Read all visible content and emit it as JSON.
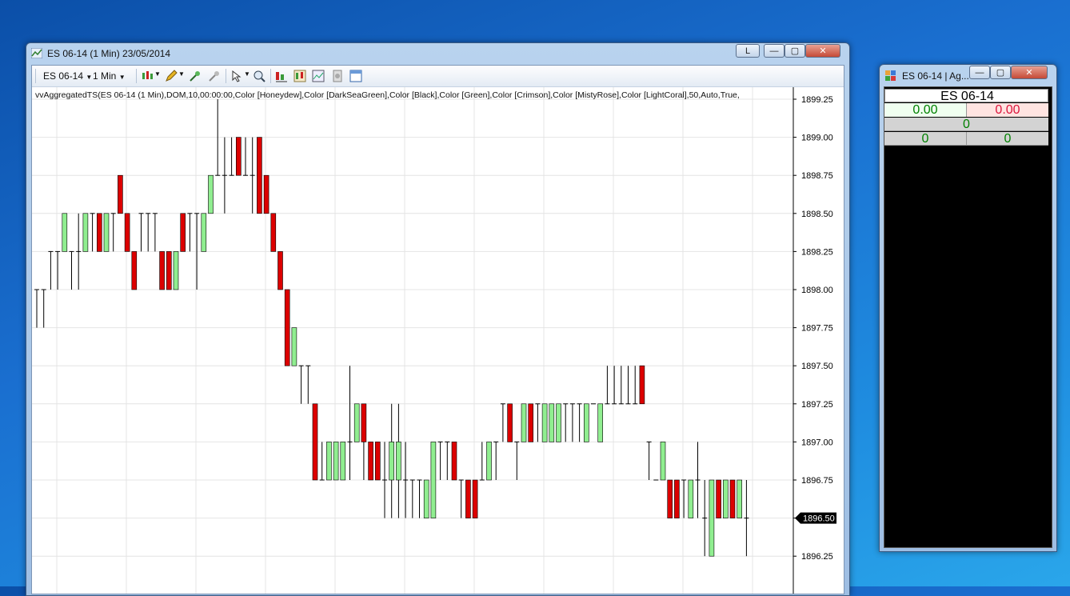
{
  "chart_window": {
    "title": "ES 06-14 (1 Min)  23/05/2014",
    "caption_buttons": {
      "link": "L",
      "minimize": "—",
      "maximize": "▢",
      "close": "✕"
    },
    "toolbar": {
      "instrument": "ES 06-14",
      "interval": "1 Min",
      "icons": [
        "chart-style-icon",
        "drawing-pencil-icon",
        "crosshair-icon",
        "zoom-cross-icon",
        "pointer-icon",
        "magnifier-icon",
        "indicators-icon",
        "strategies-icon",
        "data-box-icon",
        "properties-icon",
        "layout-icon"
      ]
    },
    "indicator_label": "vvAggregatedTS(ES 06-14 (1 Min),DOM,10,00:00:00,Color [Honeydew],Color [DarkSeaGreen],Color [Black],Color [Green],Color [Crimson],Color [MistyRose],Color [LightCoral],50,Auto,True,"
  },
  "dom_window": {
    "title": "ES 06-14 | Ag...",
    "caption_buttons": {
      "minimize": "—",
      "maximize": "▢",
      "close": "✕"
    },
    "header": "ES 06-14",
    "bid_value": "0.00",
    "ask_value": "0.00",
    "total_value": "0",
    "left_count": "0",
    "right_count": "0",
    "colors": {
      "bid_bg": "#f0fff0",
      "ask_bg": "#ffe4e1",
      "value_green": "#008000",
      "value_red": "#dc143c"
    }
  },
  "chart_data": {
    "type": "candlestick",
    "title": "",
    "xlabel": "",
    "ylabel": "",
    "ylim": [
      1896.2,
      1899.3
    ],
    "y_ticks": [
      "1899.25",
      "1899.00",
      "1898.75",
      "1898.50",
      "1898.25",
      "1898.00",
      "1897.75",
      "1897.50",
      "1897.25",
      "1897.00",
      "1896.75",
      "1896.50",
      "1896.25"
    ],
    "last_price": "1896.50",
    "colors": {
      "up": "#90ee90",
      "down": "#dc0000",
      "wick": "#000000",
      "last_price_bg": "#000000"
    },
    "bars": [
      {
        "o": 1898.0,
        "h": 1898.0,
        "l": 1897.75,
        "c": 1898.0
      },
      {
        "o": 1898.0,
        "h": 1898.0,
        "l": 1897.75,
        "c": 1898.0
      },
      {
        "o": 1898.25,
        "h": 1898.25,
        "l": 1898.0,
        "c": 1898.25
      },
      {
        "o": 1898.25,
        "h": 1898.25,
        "l": 1898.0,
        "c": 1898.25
      },
      {
        "o": 1898.25,
        "h": 1898.5,
        "l": 1898.25,
        "c": 1898.5
      },
      {
        "o": 1898.25,
        "h": 1898.25,
        "l": 1898.0,
        "c": 1898.25
      },
      {
        "o": 1898.25,
        "h": 1898.5,
        "l": 1898.0,
        "c": 1898.25
      },
      {
        "o": 1898.25,
        "h": 1898.5,
        "l": 1898.25,
        "c": 1898.5
      },
      {
        "o": 1898.5,
        "h": 1898.5,
        "l": 1898.25,
        "c": 1898.5
      },
      {
        "o": 1898.5,
        "h": 1898.5,
        "l": 1898.25,
        "c": 1898.25
      },
      {
        "o": 1898.25,
        "h": 1898.5,
        "l": 1898.25,
        "c": 1898.5
      },
      {
        "o": 1898.5,
        "h": 1898.5,
        "l": 1898.25,
        "c": 1898.5
      },
      {
        "o": 1898.75,
        "h": 1898.75,
        "l": 1898.5,
        "c": 1898.5
      },
      {
        "o": 1898.5,
        "h": 1898.5,
        "l": 1898.25,
        "c": 1898.25
      },
      {
        "o": 1898.25,
        "h": 1898.25,
        "l": 1898.0,
        "c": 1898.0
      },
      {
        "o": 1898.5,
        "h": 1898.5,
        "l": 1898.25,
        "c": 1898.5
      },
      {
        "o": 1898.5,
        "h": 1898.5,
        "l": 1898.25,
        "c": 1898.5
      },
      {
        "o": 1898.5,
        "h": 1898.5,
        "l": 1898.25,
        "c": 1898.5
      },
      {
        "o": 1898.25,
        "h": 1898.25,
        "l": 1898.0,
        "c": 1898.0
      },
      {
        "o": 1898.25,
        "h": 1898.25,
        "l": 1898.0,
        "c": 1898.0
      },
      {
        "o": 1898.0,
        "h": 1898.25,
        "l": 1898.0,
        "c": 1898.25
      },
      {
        "o": 1898.5,
        "h": 1898.5,
        "l": 1898.25,
        "c": 1898.25
      },
      {
        "o": 1898.5,
        "h": 1898.5,
        "l": 1898.25,
        "c": 1898.5
      },
      {
        "o": 1898.5,
        "h": 1898.5,
        "l": 1898.0,
        "c": 1898.5
      },
      {
        "o": 1898.25,
        "h": 1898.5,
        "l": 1898.25,
        "c": 1898.5
      },
      {
        "o": 1898.5,
        "h": 1898.75,
        "l": 1898.5,
        "c": 1898.75
      },
      {
        "o": 1898.75,
        "h": 1899.25,
        "l": 1898.75,
        "c": 1898.75
      },
      {
        "o": 1898.75,
        "h": 1899.0,
        "l": 1898.5,
        "c": 1898.75
      },
      {
        "o": 1898.75,
        "h": 1899.0,
        "l": 1898.75,
        "c": 1898.75
      },
      {
        "o": 1899.0,
        "h": 1899.0,
        "l": 1898.75,
        "c": 1898.75
      },
      {
        "o": 1898.75,
        "h": 1899.0,
        "l": 1898.75,
        "c": 1898.75
      },
      {
        "o": 1898.75,
        "h": 1899.0,
        "l": 1898.5,
        "c": 1898.75
      },
      {
        "o": 1899.0,
        "h": 1899.0,
        "l": 1898.5,
        "c": 1898.5
      },
      {
        "o": 1898.75,
        "h": 1898.75,
        "l": 1898.5,
        "c": 1898.5
      },
      {
        "o": 1898.5,
        "h": 1898.5,
        "l": 1898.25,
        "c": 1898.25
      },
      {
        "o": 1898.25,
        "h": 1898.25,
        "l": 1898.0,
        "c": 1898.0
      },
      {
        "o": 1898.0,
        "h": 1898.0,
        "l": 1897.5,
        "c": 1897.5
      },
      {
        "o": 1897.5,
        "h": 1897.75,
        "l": 1897.5,
        "c": 1897.75
      },
      {
        "o": 1897.5,
        "h": 1897.5,
        "l": 1897.25,
        "c": 1897.5
      },
      {
        "o": 1897.5,
        "h": 1897.5,
        "l": 1897.25,
        "c": 1897.5
      },
      {
        "o": 1897.25,
        "h": 1897.25,
        "l": 1896.75,
        "c": 1896.75
      },
      {
        "o": 1896.75,
        "h": 1897.0,
        "l": 1896.75,
        "c": 1896.75
      },
      {
        "o": 1896.75,
        "h": 1897.0,
        "l": 1896.75,
        "c": 1897.0
      },
      {
        "o": 1896.75,
        "h": 1897.0,
        "l": 1896.75,
        "c": 1897.0
      },
      {
        "o": 1896.75,
        "h": 1897.0,
        "l": 1896.75,
        "c": 1897.0
      },
      {
        "o": 1897.0,
        "h": 1897.5,
        "l": 1896.75,
        "c": 1897.0
      },
      {
        "o": 1897.0,
        "h": 1897.25,
        "l": 1897.0,
        "c": 1897.25
      },
      {
        "o": 1897.25,
        "h": 1897.25,
        "l": 1896.75,
        "c": 1897.0
      },
      {
        "o": 1897.0,
        "h": 1897.0,
        "l": 1896.75,
        "c": 1896.75
      },
      {
        "o": 1897.0,
        "h": 1897.0,
        "l": 1896.75,
        "c": 1896.75
      },
      {
        "o": 1896.75,
        "h": 1897.0,
        "l": 1896.5,
        "c": 1896.75
      },
      {
        "o": 1896.75,
        "h": 1897.25,
        "l": 1896.5,
        "c": 1897.0
      },
      {
        "o": 1896.75,
        "h": 1897.25,
        "l": 1896.5,
        "c": 1897.0
      },
      {
        "o": 1896.75,
        "h": 1897.0,
        "l": 1896.5,
        "c": 1896.75
      },
      {
        "o": 1896.75,
        "h": 1896.75,
        "l": 1896.5,
        "c": 1896.75
      },
      {
        "o": 1896.75,
        "h": 1896.75,
        "l": 1896.5,
        "c": 1896.75
      },
      {
        "o": 1896.5,
        "h": 1896.75,
        "l": 1896.5,
        "c": 1896.75
      },
      {
        "o": 1896.5,
        "h": 1897.0,
        "l": 1896.5,
        "c": 1897.0
      },
      {
        "o": 1897.0,
        "h": 1897.0,
        "l": 1896.75,
        "c": 1897.0
      },
      {
        "o": 1897.0,
        "h": 1897.0,
        "l": 1896.75,
        "c": 1897.0
      },
      {
        "o": 1897.0,
        "h": 1897.0,
        "l": 1896.75,
        "c": 1896.75
      },
      {
        "o": 1896.75,
        "h": 1896.75,
        "l": 1896.5,
        "c": 1896.75
      },
      {
        "o": 1896.75,
        "h": 1896.75,
        "l": 1896.5,
        "c": 1896.5
      },
      {
        "o": 1896.75,
        "h": 1896.75,
        "l": 1896.5,
        "c": 1896.5
      },
      {
        "o": 1896.75,
        "h": 1897.0,
        "l": 1896.75,
        "c": 1896.75
      },
      {
        "o": 1896.75,
        "h": 1897.0,
        "l": 1896.75,
        "c": 1897.0
      },
      {
        "o": 1897.0,
        "h": 1897.0,
        "l": 1896.75,
        "c": 1897.0
      },
      {
        "o": 1897.25,
        "h": 1897.25,
        "l": 1897.0,
        "c": 1897.25
      },
      {
        "o": 1897.25,
        "h": 1897.25,
        "l": 1897.0,
        "c": 1897.0
      },
      {
        "o": 1897.0,
        "h": 1897.0,
        "l": 1896.75,
        "c": 1897.0
      },
      {
        "o": 1897.0,
        "h": 1897.25,
        "l": 1897.0,
        "c": 1897.25
      },
      {
        "o": 1897.25,
        "h": 1897.25,
        "l": 1897.0,
        "c": 1897.0
      },
      {
        "o": 1897.25,
        "h": 1897.25,
        "l": 1897.0,
        "c": 1897.25
      },
      {
        "o": 1897.0,
        "h": 1897.25,
        "l": 1897.0,
        "c": 1897.25
      },
      {
        "o": 1897.0,
        "h": 1897.25,
        "l": 1897.0,
        "c": 1897.25
      },
      {
        "o": 1897.0,
        "h": 1897.25,
        "l": 1897.0,
        "c": 1897.25
      },
      {
        "o": 1897.25,
        "h": 1897.25,
        "l": 1897.0,
        "c": 1897.25
      },
      {
        "o": 1897.25,
        "h": 1897.25,
        "l": 1897.0,
        "c": 1897.25
      },
      {
        "o": 1897.25,
        "h": 1897.25,
        "l": 1897.0,
        "c": 1897.25
      },
      {
        "o": 1897.0,
        "h": 1897.25,
        "l": 1897.0,
        "c": 1897.25
      },
      {
        "o": 1897.25,
        "h": 1897.25,
        "l": 1897.25,
        "c": 1897.25
      },
      {
        "o": 1897.0,
        "h": 1897.25,
        "l": 1897.0,
        "c": 1897.25
      },
      {
        "o": 1897.25,
        "h": 1897.5,
        "l": 1897.25,
        "c": 1897.25
      },
      {
        "o": 1897.25,
        "h": 1897.5,
        "l": 1897.25,
        "c": 1897.25
      },
      {
        "o": 1897.25,
        "h": 1897.5,
        "l": 1897.25,
        "c": 1897.25
      },
      {
        "o": 1897.25,
        "h": 1897.5,
        "l": 1897.25,
        "c": 1897.25
      },
      {
        "o": 1897.25,
        "h": 1897.5,
        "l": 1897.25,
        "c": 1897.25
      },
      {
        "o": 1897.5,
        "h": 1897.5,
        "l": 1897.25,
        "c": 1897.25
      },
      {
        "o": 1897.0,
        "h": 1897.0,
        "l": 1896.75,
        "c": 1897.0
      },
      {
        "o": 1896.75,
        "h": 1896.75,
        "l": 1896.75,
        "c": 1896.75
      },
      {
        "o": 1896.75,
        "h": 1897.0,
        "l": 1896.75,
        "c": 1897.0
      },
      {
        "o": 1896.75,
        "h": 1896.75,
        "l": 1896.5,
        "c": 1896.5
      },
      {
        "o": 1896.75,
        "h": 1896.75,
        "l": 1896.5,
        "c": 1896.5
      },
      {
        "o": 1896.75,
        "h": 1896.75,
        "l": 1896.5,
        "c": 1896.75
      },
      {
        "o": 1896.5,
        "h": 1896.75,
        "l": 1896.5,
        "c": 1896.75
      },
      {
        "o": 1896.75,
        "h": 1897.0,
        "l": 1896.5,
        "c": 1896.75
      },
      {
        "o": 1896.5,
        "h": 1896.75,
        "l": 1896.25,
        "c": 1896.5
      },
      {
        "o": 1896.25,
        "h": 1896.75,
        "l": 1896.25,
        "c": 1896.75
      },
      {
        "o": 1896.75,
        "h": 1896.75,
        "l": 1896.5,
        "c": 1896.5
      },
      {
        "o": 1896.5,
        "h": 1896.75,
        "l": 1896.5,
        "c": 1896.75
      },
      {
        "o": 1896.75,
        "h": 1896.75,
        "l": 1896.5,
        "c": 1896.5
      },
      {
        "o": 1896.5,
        "h": 1896.75,
        "l": 1896.5,
        "c": 1896.75
      },
      {
        "o": 1896.5,
        "h": 1896.75,
        "l": 1896.25,
        "c": 1896.5
      }
    ]
  }
}
